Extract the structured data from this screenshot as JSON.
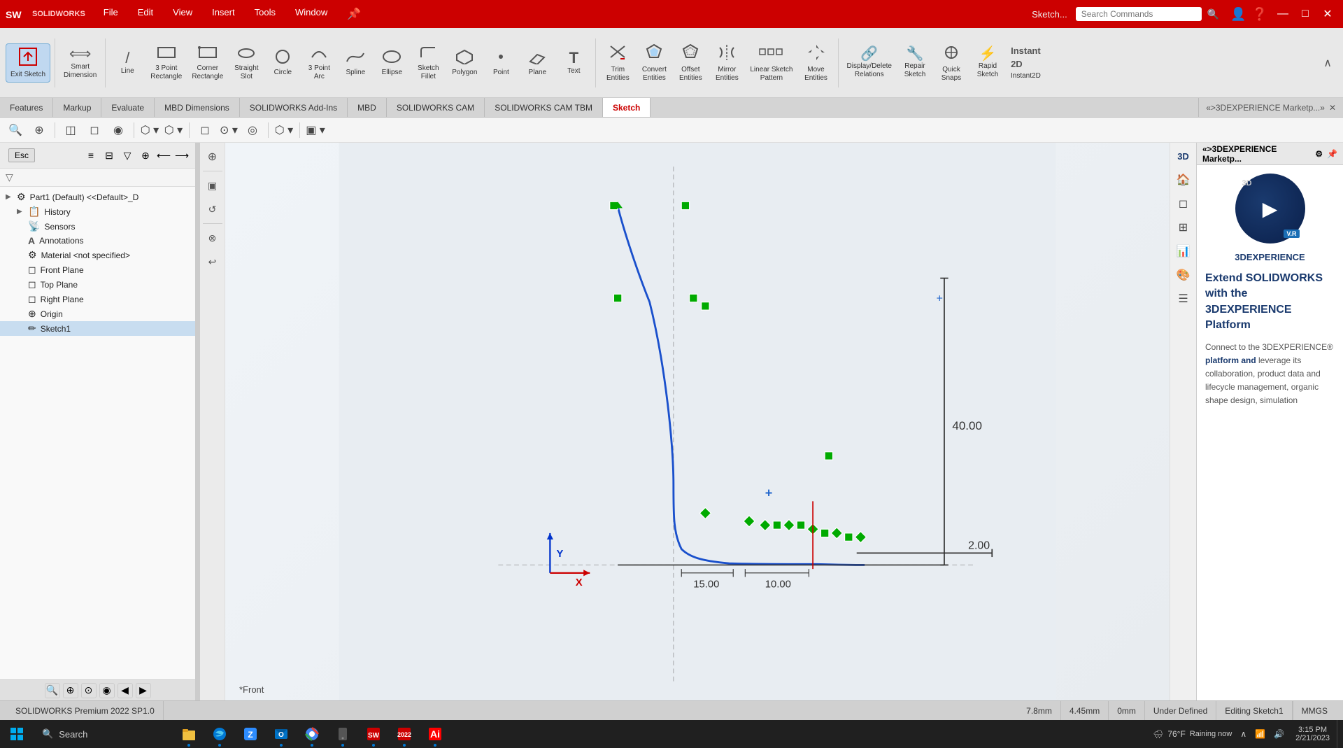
{
  "app": {
    "title": "SOLIDWORKS Premium 2022 SP1.0",
    "file_name": "Sketch...",
    "logo": "SOLIDWORKS"
  },
  "menubar": {
    "items": [
      "File",
      "Edit",
      "View",
      "Insert",
      "Tools",
      "Window"
    ]
  },
  "search": {
    "placeholder": "Search Commands",
    "icon": "search-icon"
  },
  "toolbar": {
    "groups": [
      {
        "id": "exit-sketch",
        "icon": "⬛",
        "label": "Exit\nSketch",
        "active": true
      },
      {
        "id": "smart-dimension",
        "icon": "⟺",
        "label": "Smart\nDimension"
      },
      {
        "id": "line",
        "icon": "/",
        "label": "Line"
      },
      {
        "id": "3point-rect",
        "icon": "▭",
        "label": "3 Point\nRectangle"
      },
      {
        "id": "corner-rect",
        "icon": "▭",
        "label": "Corner\nRectangle"
      },
      {
        "id": "straight-slot",
        "icon": "⬭",
        "label": "Straight\nSlot"
      },
      {
        "id": "circle",
        "icon": "○",
        "label": "Circle"
      },
      {
        "id": "3point-arc",
        "icon": "⌒",
        "label": "3 Point\nArc"
      },
      {
        "id": "spline",
        "icon": "~",
        "label": "Spline"
      },
      {
        "id": "ellipse",
        "icon": "◯",
        "label": "Ellipse"
      },
      {
        "id": "sketch-fillet",
        "icon": "⌐",
        "label": "Sketch\nFillet"
      },
      {
        "id": "polygon",
        "icon": "⬡",
        "label": "Polygon"
      },
      {
        "id": "point",
        "icon": "·",
        "label": "Point"
      },
      {
        "id": "plane",
        "icon": "◻",
        "label": "Plane"
      },
      {
        "id": "text",
        "icon": "T",
        "label": "Text"
      },
      {
        "id": "trim-entities",
        "icon": "✂",
        "label": "Trim\nEntities"
      },
      {
        "id": "convert-entities",
        "icon": "⬡",
        "label": "Convert\nEntities"
      },
      {
        "id": "offset-entities",
        "icon": "⬡",
        "label": "Offset\nEntities"
      },
      {
        "id": "mirror-entities",
        "icon": "⟺",
        "label": "Mirror\nEntities"
      },
      {
        "id": "linear-sketch-pattern",
        "icon": "⊞",
        "label": "Linear Sketch\nPattern"
      },
      {
        "id": "move-entities",
        "icon": "✥",
        "label": "Move\nEntities"
      },
      {
        "id": "display-delete-relations",
        "icon": "🔗",
        "label": "Display/Delete\nRelations"
      },
      {
        "id": "repair-sketch",
        "icon": "🔧",
        "label": "Repair\nSketch"
      },
      {
        "id": "quick-snaps",
        "icon": "⊕",
        "label": "Quick\nSnaps"
      },
      {
        "id": "rapid-sketch",
        "icon": "⚡",
        "label": "Rapid\nSketch"
      },
      {
        "id": "instant2d",
        "icon": "2D",
        "label": "Instant2D"
      }
    ]
  },
  "tabs": {
    "items": [
      "Features",
      "Markup",
      "Evaluate",
      "MBD Dimensions",
      "SOLIDWORKS Add-Ins",
      "MBD",
      "SOLIDWORKS CAM",
      "SOLIDWORKS CAM TBM",
      "Sketch"
    ],
    "active": "Sketch"
  },
  "feature_tree": {
    "root": "Part1 (Default) <<Default>_D",
    "items": [
      {
        "id": "history",
        "label": "History",
        "icon": "📋",
        "indent": 1,
        "expanded": false
      },
      {
        "id": "sensors",
        "label": "Sensors",
        "icon": "📡",
        "indent": 1
      },
      {
        "id": "annotations",
        "label": "Annotations",
        "icon": "A",
        "indent": 1
      },
      {
        "id": "material",
        "label": "Material <not specified>",
        "icon": "⚙",
        "indent": 1
      },
      {
        "id": "front-plane",
        "label": "Front Plane",
        "icon": "◻",
        "indent": 1
      },
      {
        "id": "top-plane",
        "label": "Top Plane",
        "icon": "◻",
        "indent": 1
      },
      {
        "id": "right-plane",
        "label": "Right Plane",
        "icon": "◻",
        "indent": 1
      },
      {
        "id": "origin",
        "label": "Origin",
        "icon": "⊕",
        "indent": 1
      },
      {
        "id": "sketch1",
        "label": "Sketch1",
        "icon": "✏",
        "indent": 1
      }
    ]
  },
  "canvas": {
    "view_name": "*Front",
    "dimension_40": "40.00",
    "dimension_2": "2.00",
    "dimension_15": "15.00",
    "dimension_10": "10.00"
  },
  "statusbar": {
    "app_version": "SOLIDWORKS Premium 2022 SP1.0",
    "coord_x": "7.8mm",
    "coord_y": "4.45mm",
    "coord_z": "0mm",
    "state": "Under Defined",
    "editing": "Editing Sketch1",
    "units": "MMGS"
  },
  "right_panel": {
    "title": "«&3DEXPERIENCE Marketp...»",
    "brand": "3DEXPERIENCE",
    "heading": "Extend SOLIDWORKS with the 3DEXPERIENCE Platform",
    "description_parts": [
      {
        "text": "Connect to the 3DEXPERIENCE® ",
        "bold": false
      },
      {
        "text": "platform and",
        "bold": true
      },
      {
        "text": " leverage its collaboration, product data and lifecycle management, organic shape design, simulation",
        "bold": false
      }
    ]
  },
  "taskbar": {
    "search_label": "Search",
    "time": "3:15 PM",
    "date": "2/21/2023",
    "weather": "76°F",
    "weather_desc": "Raining now"
  },
  "icons": {
    "search": "🔍",
    "windows_start": "⊞",
    "minimize": "—",
    "maximize": "□",
    "close": "✕"
  }
}
